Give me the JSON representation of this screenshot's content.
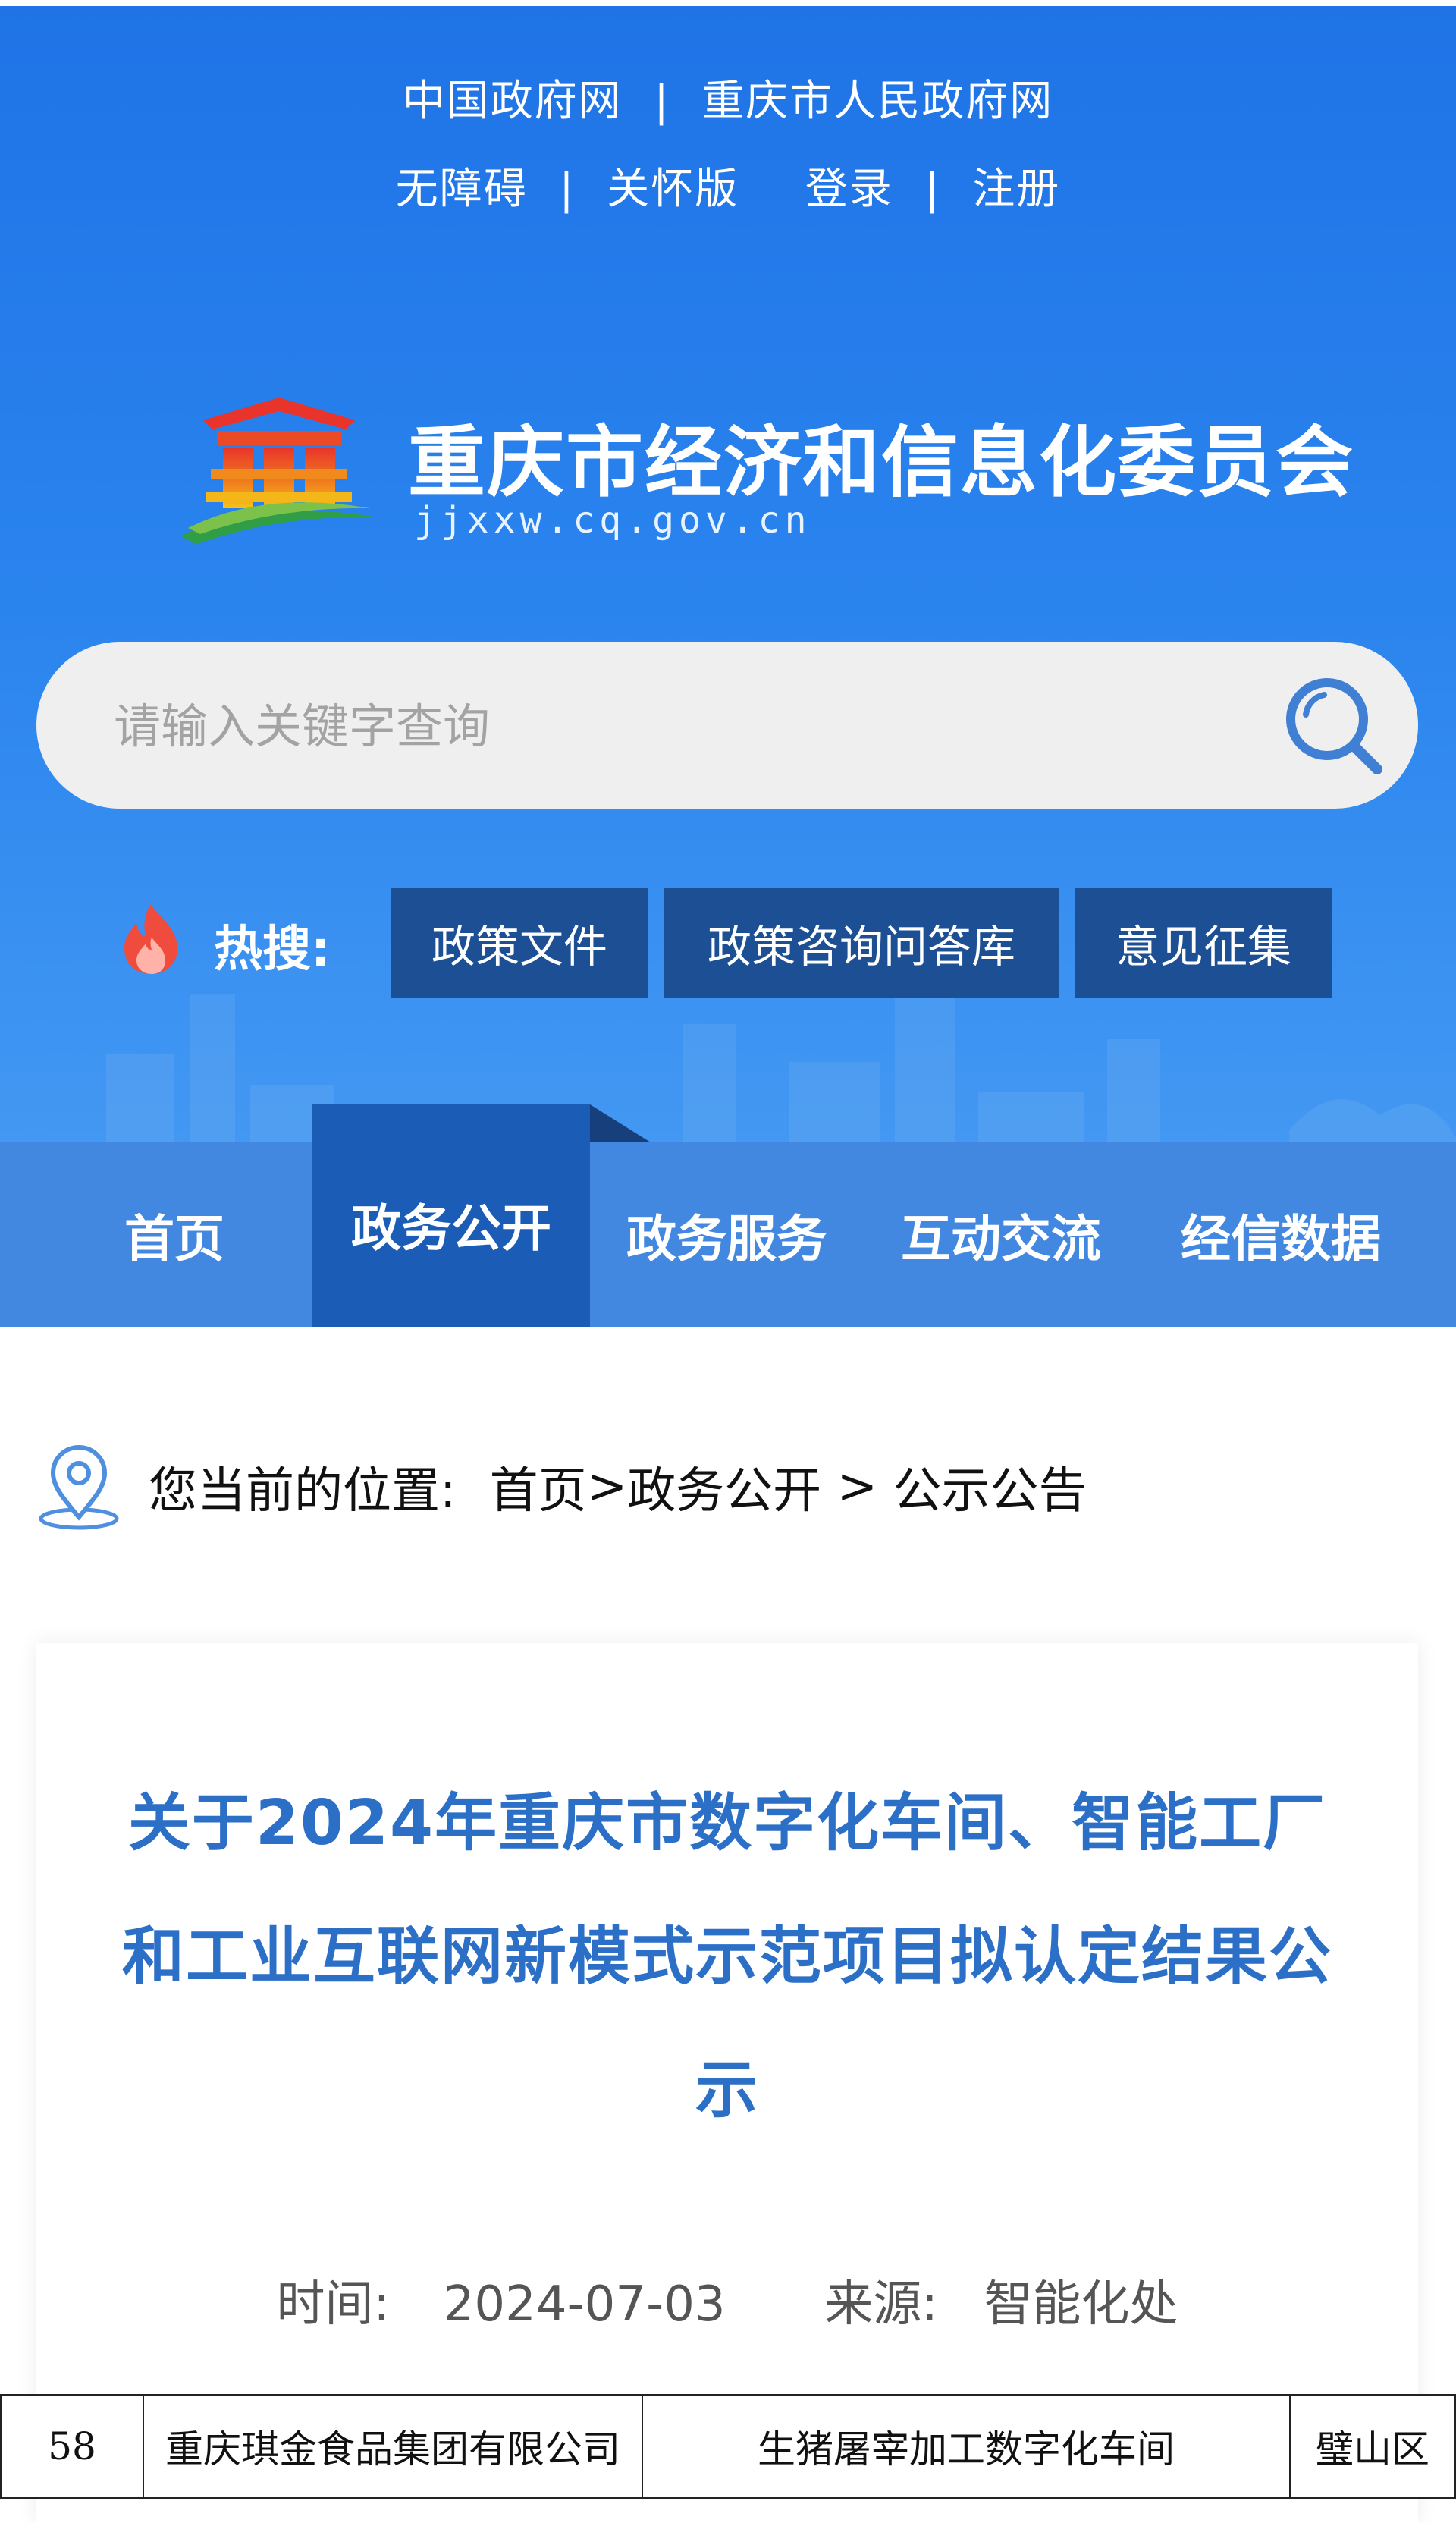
{
  "top_links": {
    "gov_cn": "中国政府网",
    "sep1": "|",
    "cq_gov": "重庆市人民政府网",
    "accessible": "无障碍",
    "sep2": "|",
    "care": "关怀版",
    "login": "登录",
    "sep3": "|",
    "register": "注册"
  },
  "org": {
    "name": "重庆市经济和信息化委员会",
    "domain": "jjxxw.cq.gov.cn"
  },
  "search": {
    "placeholder": "请输入关键字查询",
    "icon": "search-icon"
  },
  "hot_search": {
    "label": "热搜:",
    "tags": [
      "政策文件",
      "政策咨询问答库",
      "意见征集"
    ]
  },
  "nav": {
    "items": [
      "首页",
      "政务公开",
      "政务服务",
      "互动交流",
      "经信数据"
    ],
    "active": "政务公开"
  },
  "breadcrumb": {
    "prefix": "您当前的位置:",
    "home": "首页",
    "sep1": ">",
    "section": "政务公开",
    "sep2": " > ",
    "current": "公示公告"
  },
  "article": {
    "title": "关于2024年重庆市数字化车间、智能工厂和工业互联网新模式示范项目拟认定结果公示",
    "time_label": "时间:",
    "date": "2024-07-03",
    "source_label": "来源:",
    "source": "智能化处"
  },
  "table_row": {
    "no": "58",
    "company": "重庆琪金食品集团有限公司",
    "project": "生猪屠宰加工数字化车间",
    "district": "璧山区"
  },
  "colors": {
    "header_blue": "#2a84ee",
    "nav_blue": "#4388e0",
    "nav_active": "#1a5cb6",
    "hot_tag_bg": "#1d4f94",
    "title_blue": "#2c6fc7"
  }
}
